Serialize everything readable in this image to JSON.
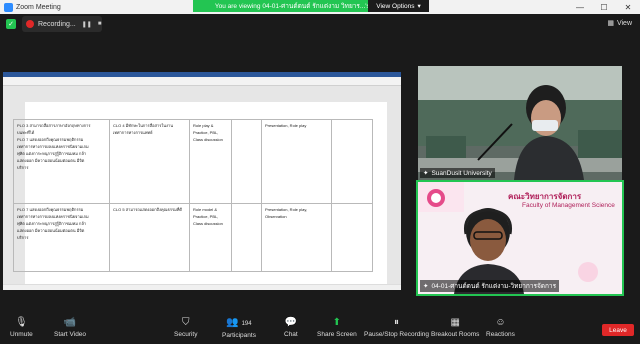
{
  "window": {
    "title": "Zoom Meeting",
    "controls": [
      "—",
      "☐",
      "✕"
    ]
  },
  "share_banner": {
    "text": "You are viewing 04-01-ศานต์ตนต์ รักแต่งาม วิทยาร...'s screen",
    "options_label": "View Options"
  },
  "recording": {
    "label": "Recording..."
  },
  "view_button": {
    "label": "View"
  },
  "document": {
    "rows": [
      {
        "plo": [
          "PLO 3 สามารถสื่อสารภาษาอังกฤษทางการ",
          "บนทะที่ได้",
          "PLO 7 แสดงออกถึงคุณธรรมพฤติกรรม",
          "เทศาการทางการผลงแห่งคราชนิยจามเกม",
          "พุ่ทิต แต่งการะหนุการสู่รู้ถิกาชเมทม กล้า",
          "แสดงออก มีความอ่อนน้อมต่อมตน มีจิต",
          "บริการ"
        ],
        "clo": [
          "CLO 4 มีทักษะในการสื่อสารในงาน",
          "เทศาการทางการแพทย์"
        ],
        "method": [
          "Role play &",
          "Practice, PBL,",
          "Class discussion"
        ],
        "assess": [
          "Presentation, Role play"
        ]
      },
      {
        "plo": [
          "PLO 7 แสดงออกถึงคุณธรรมพฤติกรรม",
          "เทศาการทางการผลงแห่งคราชนิยจามเกม",
          "พุ่ทิต แต่งการะหนุการสู่รู้ถิกาชเมทม กล้า",
          "แสดงออก มีความอ่อนน้อมต่อมตน มีจิต",
          "บริการ"
        ],
        "clo": [
          "CLO 5 สามารถแสดงออกถึงคุณธรรมที่ดี"
        ],
        "method": [
          "Role model &",
          "Practice, PBL,",
          "Class discussion"
        ],
        "assess": [
          "Presentation, Role play, Observation"
        ]
      }
    ]
  },
  "participants_tiles": [
    {
      "name": "SuanDusit University"
    },
    {
      "name": "04-01-ศานต์ตนต์ รักแต่งาม-วิทยาการจัดการ",
      "banner_th": "คณะวิทยาการจัดการ",
      "banner_en": "Faculty of Management Science"
    }
  ],
  "toolbar": {
    "unmute": "Unmute",
    "start_video": "Start Video",
    "security": "Security",
    "participants": "Participants",
    "participants_count": "194",
    "chat": "Chat",
    "share_screen": "Share Screen",
    "pause_recording": "Pause/Stop Recording",
    "breakout": "Breakout Rooms",
    "reactions": "Reactions",
    "leave": "Leave"
  },
  "colors": {
    "accent_green": "#23c552",
    "leave_red": "#e02828",
    "zoom_blue": "#2d8cff",
    "word_blue": "#2b579a"
  }
}
